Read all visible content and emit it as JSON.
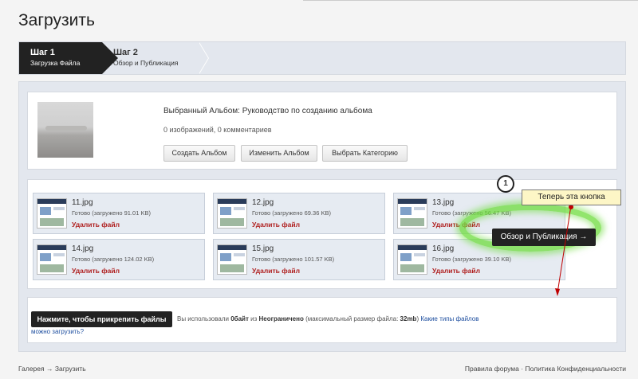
{
  "page": {
    "title": "Загрузить"
  },
  "steps": [
    {
      "title": "Шаг 1",
      "subtitle": "Загрузка Файла"
    },
    {
      "title": "Шаг 2",
      "subtitle": "Обзор и Публикация"
    }
  ],
  "album": {
    "name": "Выбранный Альбом: Руководство по созданию альбома",
    "counts": "0 изображений, 0 комментариев",
    "buttons": {
      "create": "Создать Альбом",
      "edit": "Изменить Альбом",
      "category": "Выбрать Категорию"
    }
  },
  "files": [
    {
      "name": "11.jpg",
      "status": "Готово (загружено 91.01 KB)",
      "delete": "Удалить файл"
    },
    {
      "name": "12.jpg",
      "status": "Готово (загружено 69.36 KB)",
      "delete": "Удалить файл"
    },
    {
      "name": "13.jpg",
      "status": "Готово (загружено 56.47 KB)",
      "delete": "Удалить файл"
    },
    {
      "name": "14.jpg",
      "status": "Готово (загружено 124.02 KB)",
      "delete": "Удалить файл"
    },
    {
      "name": "15.jpg",
      "status": "Готово (загружено 101.57 KB)",
      "delete": "Удалить файл"
    },
    {
      "name": "16.jpg",
      "status": "Готово (загружено 39.10 KB)",
      "delete": "Удалить файл"
    }
  ],
  "upload": {
    "attach_button": "Нажмите, чтобы прикрепить файлы",
    "usage_prefix": "Вы использовали ",
    "used": "0байт",
    "usage_mid": " из ",
    "limit": "Неограничено",
    "usage_max_prefix": " (максимальный размер файла: ",
    "max_size": "32mb",
    "usage_max_suffix": ") ",
    "types_link": "Какие типы файлов",
    "types_link_cont": "можно загрузить?",
    "review_button": "Обзор и Публикация →"
  },
  "annotation": {
    "number": "1",
    "text": "Теперь эта кнопка"
  },
  "footer": {
    "crumb_gallery": "Галерея",
    "crumb_sep": "→",
    "crumb_upload": "Загрузить",
    "rules": "Правила форума",
    "dot": "·",
    "privacy": "Политика Конфиденциальности"
  }
}
